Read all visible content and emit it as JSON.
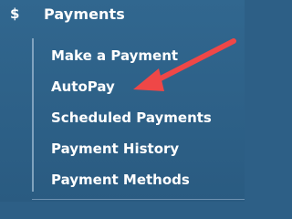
{
  "section": {
    "icon": "dollar-icon",
    "title": "Payments"
  },
  "menu": {
    "items": [
      {
        "label": "Make a Payment"
      },
      {
        "label": "AutoPay"
      },
      {
        "label": "Scheduled Payments"
      },
      {
        "label": "Payment History"
      },
      {
        "label": "Payment Methods"
      }
    ]
  },
  "annotation": {
    "arrow_color": "#ef4747",
    "target": "AutoPay"
  }
}
